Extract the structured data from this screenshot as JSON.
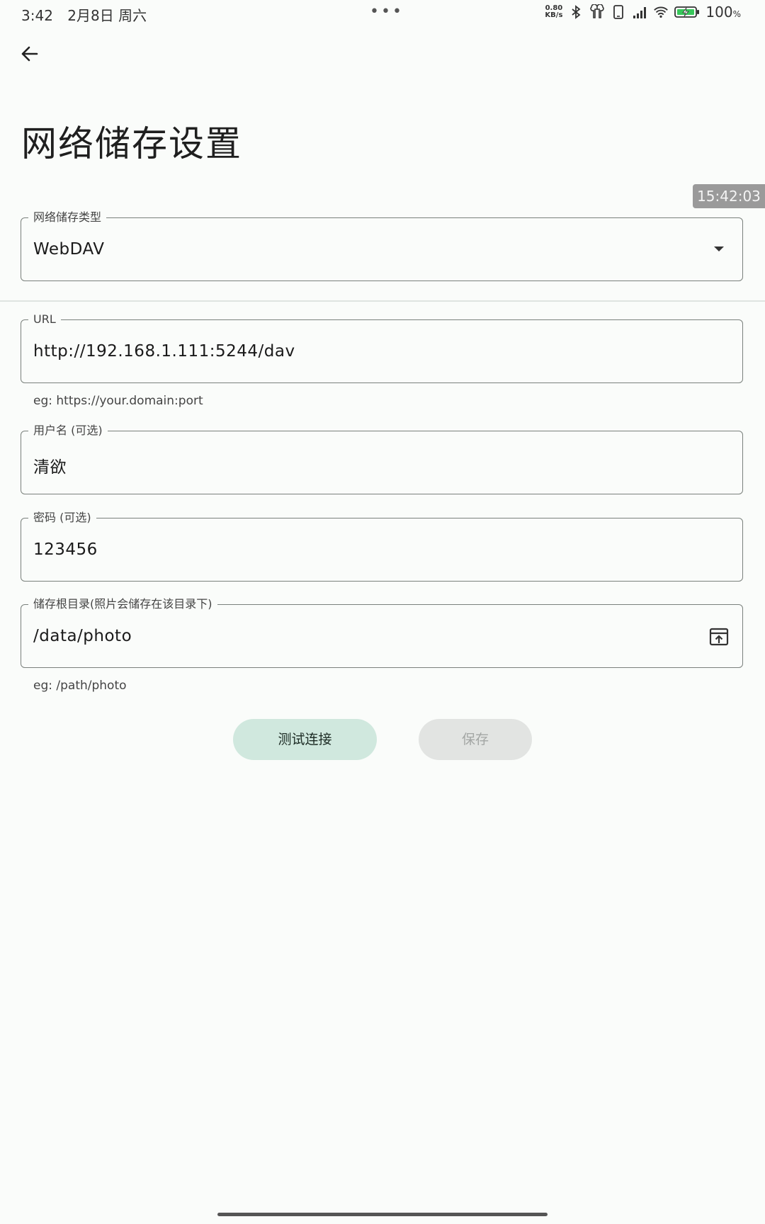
{
  "status_bar": {
    "time": "3:42",
    "date": "2月8日 周六",
    "dots": "•••",
    "net_speed_value": "0.80",
    "net_speed_unit": "KB/s",
    "battery_percent": "100",
    "battery_unit": "%"
  },
  "header": {
    "title": "网络储存设置"
  },
  "overlay": {
    "timestamp": "15:42:03"
  },
  "form": {
    "storage_type": {
      "label": "网络储存类型",
      "value": "WebDAV"
    },
    "url": {
      "label": "URL",
      "value": "http://192.168.1.111:5244/dav",
      "helper": "eg: https://your.domain:port"
    },
    "username": {
      "label": "用户名 (可选)",
      "value": "清欲"
    },
    "password": {
      "label": "密码 (可选)",
      "value": "123456"
    },
    "root_dir": {
      "label": "储存根目录(照片会储存在该目录下)",
      "value": "/data/photo",
      "helper": "eg: /path/photo"
    }
  },
  "actions": {
    "test_label": "测试连接",
    "save_label": "保存"
  },
  "colors": {
    "primary_tonal": "#d0e8de",
    "disabled": "#e2e4e2",
    "background": "#fafcfa"
  },
  "icons": [
    "back-arrow-icon",
    "bluetooth-icon",
    "earbuds-icon",
    "phone-icon",
    "signal-icon",
    "wifi-icon",
    "battery-icon",
    "dropdown-arrow-icon",
    "folder-upload-icon"
  ]
}
